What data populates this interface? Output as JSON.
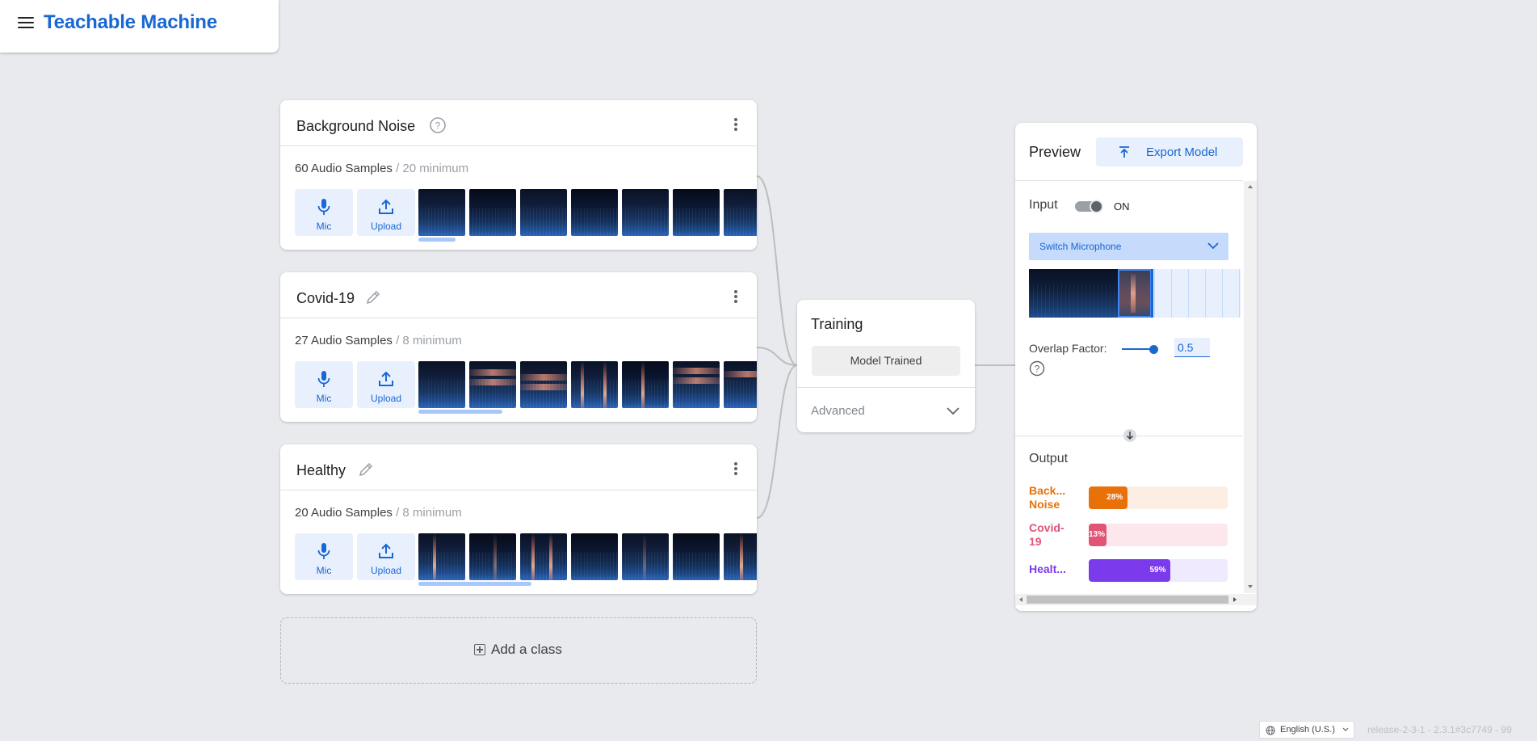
{
  "header": {
    "title": "Teachable Machine",
    "menu_icon": "menu-icon"
  },
  "classes": [
    {
      "name": "Background Noise",
      "title_icon": "help-icon",
      "count_text": "60 Audio Samples",
      "minimum_text": " / 20 minimum",
      "mic_label": "Mic",
      "upload_label": "Upload"
    },
    {
      "name": "Covid-19",
      "title_icon": "edit-icon",
      "count_text": "27 Audio Samples",
      "minimum_text": " / 8 minimum",
      "mic_label": "Mic",
      "upload_label": "Upload"
    },
    {
      "name": "Healthy",
      "title_icon": "edit-icon",
      "count_text": "20 Audio Samples",
      "minimum_text": " / 8 minimum",
      "mic_label": "Mic",
      "upload_label": "Upload"
    }
  ],
  "add_class": {
    "label": "Add a class"
  },
  "training": {
    "title": "Training",
    "button_label": "Model Trained",
    "advanced_label": "Advanced"
  },
  "preview": {
    "title": "Preview",
    "export_label": "Export Model",
    "input_label": "Input",
    "toggle_state": "ON",
    "switch_mic_label": "Switch Microphone",
    "overlap_label": "Overlap Factor:",
    "overlap_value": "0.5",
    "overlap_slider_fraction": 0.5,
    "output_title": "Output",
    "outputs": [
      {
        "label": "Back...\nNoise",
        "percent_text": "28%",
        "fraction": 0.28,
        "color": "#e8710a",
        "track": "#fdeee4"
      },
      {
        "label": "Covid-\n19",
        "percent_text": "13%",
        "fraction": 0.13,
        "color": "#e05575",
        "track": "#fce8ec"
      },
      {
        "label": "Healt...",
        "percent_text": "59%",
        "fraction": 0.59,
        "color": "#7c3aed",
        "track": "#efeafd"
      }
    ]
  },
  "footer": {
    "language": "English (U.S.)",
    "release": "release-2-3-1 - 2.3.1#3c7749 - 99"
  },
  "colors": {
    "accent": "#1967d2",
    "background": "#e8eaed"
  }
}
